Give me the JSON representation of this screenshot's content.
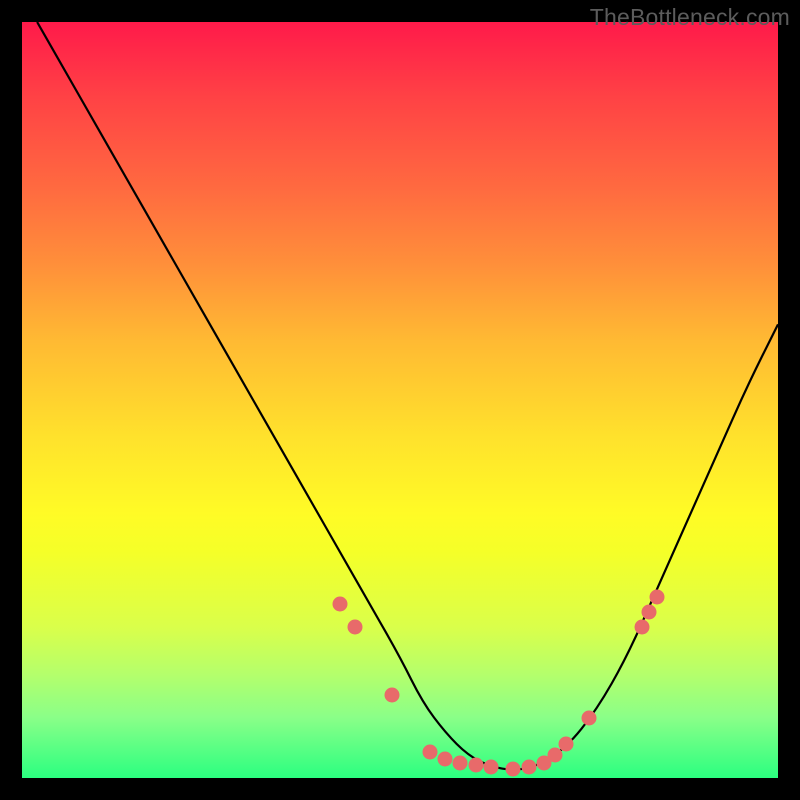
{
  "watermark": "TheBottleneck.com",
  "chart_data": {
    "type": "line",
    "title": "",
    "xlabel": "",
    "ylabel": "",
    "xlim": [
      0,
      100
    ],
    "ylim": [
      0,
      100
    ],
    "series": [
      {
        "name": "curve",
        "x": [
          2,
          6,
          10,
          14,
          18,
          22,
          26,
          30,
          34,
          38,
          42,
          46,
          50,
          53,
          56,
          59,
          62,
          65,
          68,
          72,
          76,
          80,
          84,
          88,
          92,
          96,
          100
        ],
        "y": [
          100,
          93,
          86,
          79,
          72,
          65,
          58,
          51,
          44,
          37,
          30,
          23,
          16,
          10,
          6,
          3,
          1.5,
          1,
          1.5,
          4,
          9,
          16,
          25,
          34,
          43,
          52,
          60
        ]
      }
    ],
    "markers": [
      {
        "x": 42,
        "y": 23
      },
      {
        "x": 44,
        "y": 20
      },
      {
        "x": 49,
        "y": 11
      },
      {
        "x": 54,
        "y": 3.5
      },
      {
        "x": 56,
        "y": 2.5
      },
      {
        "x": 58,
        "y": 2
      },
      {
        "x": 60,
        "y": 1.7
      },
      {
        "x": 62,
        "y": 1.5
      },
      {
        "x": 65,
        "y": 1.2
      },
      {
        "x": 67,
        "y": 1.5
      },
      {
        "x": 69,
        "y": 2
      },
      {
        "x": 70.5,
        "y": 3
      },
      {
        "x": 72,
        "y": 4.5
      },
      {
        "x": 75,
        "y": 8
      },
      {
        "x": 82,
        "y": 20
      },
      {
        "x": 83,
        "y": 22
      },
      {
        "x": 84,
        "y": 24
      }
    ],
    "gradient_stops": [
      {
        "pos": 0,
        "color": "#ff1a4a"
      },
      {
        "pos": 55,
        "color": "#ffe22c"
      },
      {
        "pos": 100,
        "color": "#2bff80"
      }
    ]
  }
}
